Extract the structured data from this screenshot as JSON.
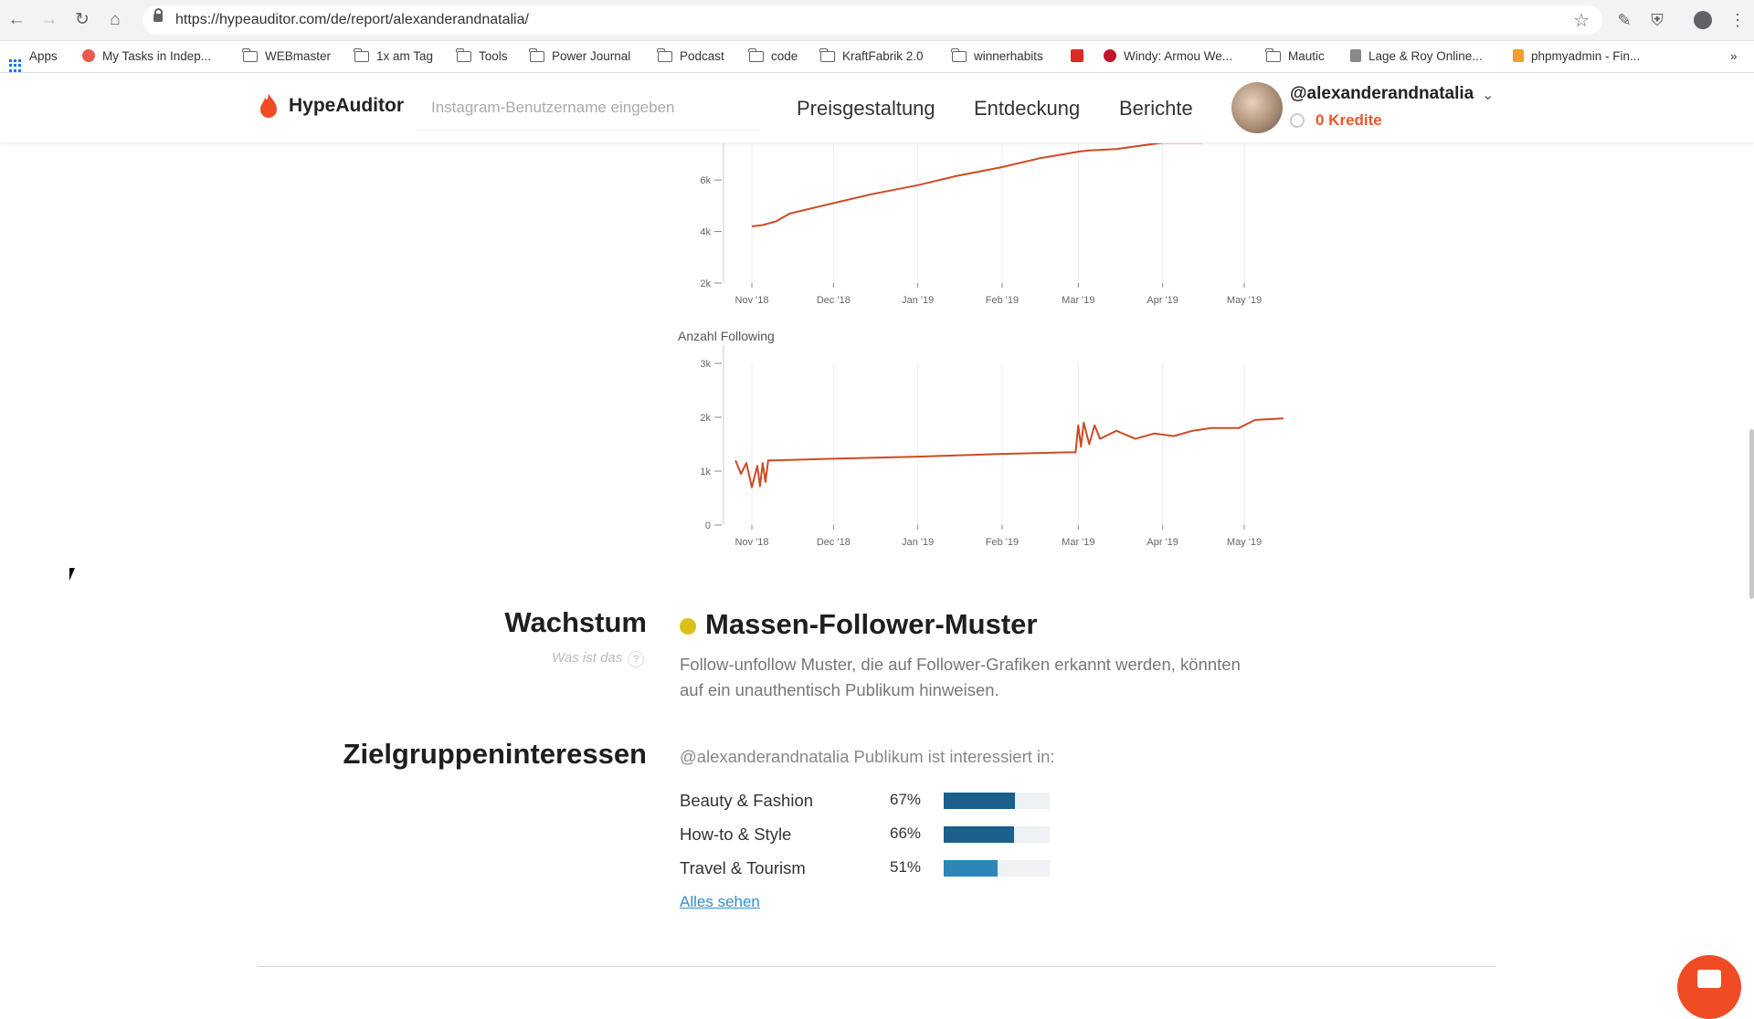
{
  "browser": {
    "url": "https://hypeauditor.com/de/report/alexanderandnatalia/",
    "bookmarks": [
      {
        "label": "Apps",
        "icon": "apps-grid-icon"
      },
      {
        "label": "My Tasks in Indep...",
        "icon": "asana-icon"
      },
      {
        "label": "WEBmaster",
        "icon": "folder-icon"
      },
      {
        "label": "1x am Tag",
        "icon": "folder-icon"
      },
      {
        "label": "Tools",
        "icon": "folder-icon"
      },
      {
        "label": "Power Journal",
        "icon": "folder-icon"
      },
      {
        "label": "Podcast",
        "icon": "folder-icon"
      },
      {
        "label": "code",
        "icon": "folder-icon"
      },
      {
        "label": "KraftFabrik 2.0",
        "icon": "folder-icon"
      },
      {
        "label": "winnerhabits",
        "icon": "folder-icon"
      },
      {
        "label": "Windy: Armou We...",
        "icon": "vivaldi-icon"
      },
      {
        "label": "Mautic",
        "icon": "folder-icon"
      },
      {
        "label": "Lage & Roy Online...",
        "icon": "lage-roy-icon"
      },
      {
        "label": "phpmyadmin - Fin...",
        "icon": "phpmyadmin-icon"
      }
    ],
    "overflow": "»"
  },
  "header": {
    "brand": "HypeAuditor",
    "search_placeholder": "Instagram-Benutzername eingeben",
    "nav": [
      "Preisgestaltung",
      "Entdeckung",
      "Berichte"
    ],
    "username": "@alexanderandnatalia",
    "credits": "0 Kredite",
    "accent": "#e8582c"
  },
  "chart_data": [
    {
      "type": "line",
      "title": "",
      "x": [
        "2018-11-01",
        "2018-11-05",
        "2018-11-10",
        "2018-11-15",
        "2018-12-01",
        "2018-12-15",
        "2019-01-01",
        "2019-01-15",
        "2019-02-01",
        "2019-02-15",
        "2019-03-01",
        "2019-03-05",
        "2019-03-15",
        "2019-04-01",
        "2019-04-15",
        "2019-05-01"
      ],
      "series": [
        {
          "values": [
            4200,
            4250,
            4400,
            4700,
            5100,
            5450,
            5800,
            6150,
            6500,
            6850,
            7100,
            7150,
            7200,
            7450,
            7450,
            7550
          ]
        }
      ],
      "xticks": [
        "Nov '18",
        "Dec '18",
        "Jan '19",
        "Feb '19",
        "Mar '19",
        "Apr '19",
        "May '19"
      ],
      "yticks": [
        "2k",
        "4k",
        "6k"
      ],
      "ylim": [
        2000,
        7600
      ],
      "color": "#cc4b24",
      "grid": true
    },
    {
      "type": "line",
      "title": "Anzahl Following",
      "x": [
        "2018-10-26",
        "2018-10-28",
        "2018-10-30",
        "2018-11-01",
        "2018-11-03",
        "2018-11-04",
        "2018-11-05",
        "2018-11-06",
        "2018-11-07",
        "2018-11-09",
        "2018-12-01",
        "2019-01-01",
        "2019-02-01",
        "2019-02-25",
        "2019-02-28",
        "2019-03-01",
        "2019-03-02",
        "2019-03-03",
        "2019-03-05",
        "2019-03-07",
        "2019-03-09",
        "2019-03-15",
        "2019-03-22",
        "2019-03-29",
        "2019-04-05",
        "2019-04-12",
        "2019-04-19",
        "2019-04-29",
        "2019-05-05",
        "2019-05-20"
      ],
      "series": [
        {
          "values": [
            1200,
            950,
            1150,
            700,
            1100,
            720,
            1150,
            800,
            1200,
            1200,
            1230,
            1270,
            1320,
            1350,
            1350,
            1850,
            1450,
            1900,
            1500,
            1850,
            1600,
            1750,
            1600,
            1700,
            1650,
            1750,
            1800,
            1800,
            1950,
            1980
          ]
        }
      ],
      "xticks": [
        "Nov '18",
        "Dec '18",
        "Jan '19",
        "Feb '19",
        "Mar '19",
        "Apr '19",
        "May '19"
      ],
      "yticks": [
        "0",
        "1k",
        "2k",
        "3k"
      ],
      "ylim": [
        0,
        3000
      ],
      "color": "#cc4b24",
      "grid": true
    }
  ],
  "growth": {
    "section_title": "Wachstum",
    "whats_this": "Was ist das",
    "whats_this_icon": "?",
    "status_color": "#ddbf1c",
    "pattern_title": "Massen-Follower-Muster",
    "description": "Follow-unfollow Muster, die auf Follower-Grafiken erkannt werden, könnten auf ein unauthentisch Publikum hinweisen."
  },
  "interests": {
    "section_title": "Zielgruppeninteressen",
    "intro": "@alexanderandnatalia Publikum ist interessiert in:",
    "items": [
      {
        "name": "Beauty & Fashion",
        "pct": "67%",
        "value": 0.67,
        "color": "#1b5f8c"
      },
      {
        "name": "How-to & Style",
        "pct": "66%",
        "value": 0.66,
        "color": "#1b5f8c"
      },
      {
        "name": "Travel & Tourism",
        "pct": "51%",
        "value": 0.51,
        "color": "#2e86b8"
      }
    ],
    "see_all": "Alles sehen"
  }
}
